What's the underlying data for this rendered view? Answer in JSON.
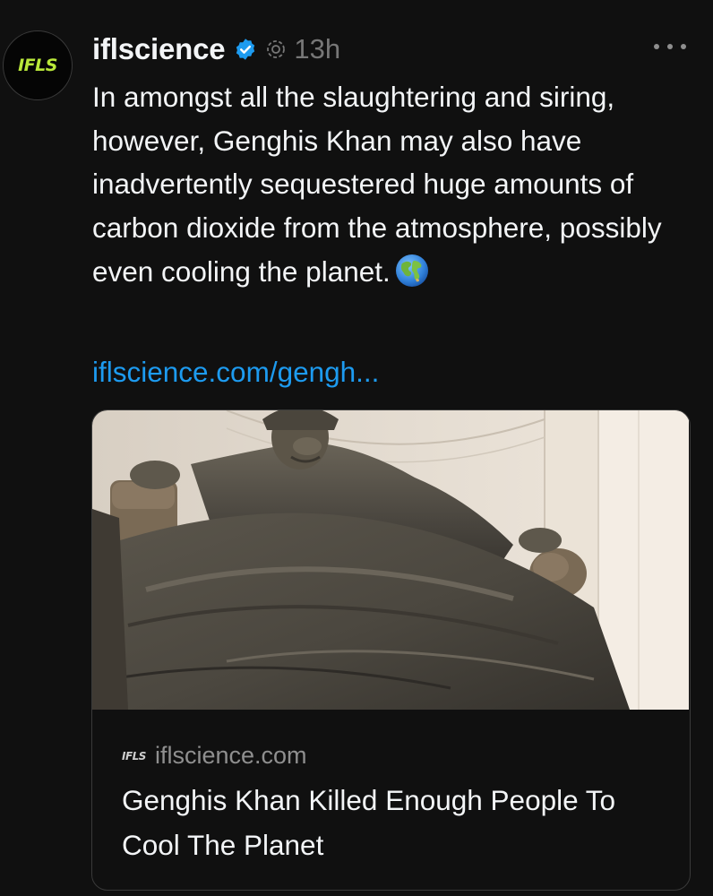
{
  "post": {
    "avatar_text": "IFLS",
    "username": "iflscience",
    "timestamp": "13h",
    "text": "In amongst all the slaughtering and siring, however, Genghis Khan may also have inadvertently sequestered huge amounts of carbon dioxide from the atmosphere, possibly even cooling the planet.",
    "link_text": "iflscience.com/gengh..."
  },
  "card": {
    "logo_text": "IFLS",
    "domain": "iflscience.com",
    "title": "Genghis Khan Killed Enough People To Cool The Planet"
  },
  "colors": {
    "background": "#101010",
    "text": "#f3f5f7",
    "muted": "#777777",
    "link": "#1d9bf0",
    "verified_badge": "#1d9bf0",
    "avatar_logo": "#b9e83a"
  },
  "icons": {
    "verified": "verified-badge-icon",
    "thread": "thread-icon",
    "more": "more-options-icon",
    "globe": "globe-emoji-icon"
  }
}
